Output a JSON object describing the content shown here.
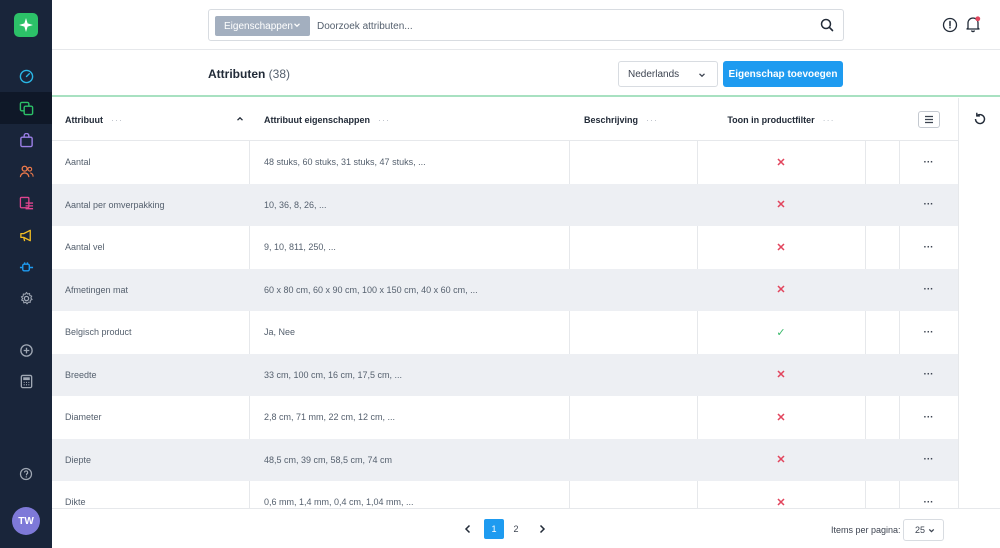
{
  "sidebar": {
    "avatar_initials": "TW",
    "items": [
      {
        "icon": "gauge-icon",
        "color": "#2ab6e5"
      },
      {
        "icon": "copy-icon",
        "color": "#2cc168"
      },
      {
        "icon": "shopping-bag-icon",
        "color": "#9b7fe6"
      },
      {
        "icon": "users-icon",
        "color": "#ef7a4b"
      },
      {
        "icon": "list-icon",
        "color": "#e0448f"
      },
      {
        "icon": "megaphone-icon",
        "color": "#f1bd22"
      },
      {
        "icon": "plug-icon",
        "color": "#1e9bf0"
      },
      {
        "icon": "gear-icon",
        "color": "#a0a8b4"
      },
      {
        "icon": "plus-circle-icon",
        "color": "#a0a8b4"
      },
      {
        "icon": "calculator-icon",
        "color": "#a0a8b4"
      },
      {
        "icon": "help-circle-icon",
        "color": "#a0a8b4"
      }
    ]
  },
  "topbar": {
    "scope_label": "Eigenschappen",
    "search_placeholder": "Doorzoek attributen..."
  },
  "header": {
    "title": "Attributen",
    "count": "(38)",
    "language": "Nederlands",
    "add_button": "Eigenschap toevoegen"
  },
  "table": {
    "columns": {
      "attribute": "Attribuut",
      "properties": "Attribuut eigenschappen",
      "description": "Beschrijving",
      "filter": "Toon in productfilter"
    },
    "rows": [
      {
        "name": "Aantal",
        "values": "48 stuks, 60 stuks, 31 stuks, 47 stuks, ...",
        "description": "",
        "filter": false
      },
      {
        "name": "Aantal per omverpakking",
        "values": "10, 36, 8, 26, ...",
        "description": "",
        "filter": false
      },
      {
        "name": "Aantal vel",
        "values": "9, 10, 811, 250, ...",
        "description": "",
        "filter": false
      },
      {
        "name": "Afmetingen mat",
        "values": "60 x 80 cm, 60 x 90 cm, 100 x 150 cm, 40 x 60 cm, ...",
        "description": "",
        "filter": false
      },
      {
        "name": "Belgisch product",
        "values": "Ja, Nee",
        "description": "",
        "filter": true
      },
      {
        "name": "Breedte",
        "values": "33 cm, 100 cm, 16 cm, 17,5 cm, ...",
        "description": "",
        "filter": false
      },
      {
        "name": "Diameter",
        "values": "2,8 cm, 71 mm, 22 cm, 12 cm, ...",
        "description": "",
        "filter": false
      },
      {
        "name": "Diepte",
        "values": "48,5 cm, 39 cm, 58,5 cm, 74 cm",
        "description": "",
        "filter": false
      },
      {
        "name": "Dikte",
        "values": "0,6 mm, 1,4 mm, 0,4 cm, 1,04 mm, ...",
        "description": "",
        "filter": false
      }
    ],
    "more_label": "···",
    "header_dots": "···"
  },
  "footer": {
    "pages": [
      "1",
      "2"
    ],
    "current_page": "1",
    "items_per_page_label": "Items per pagina:",
    "items_per_page": "25"
  }
}
